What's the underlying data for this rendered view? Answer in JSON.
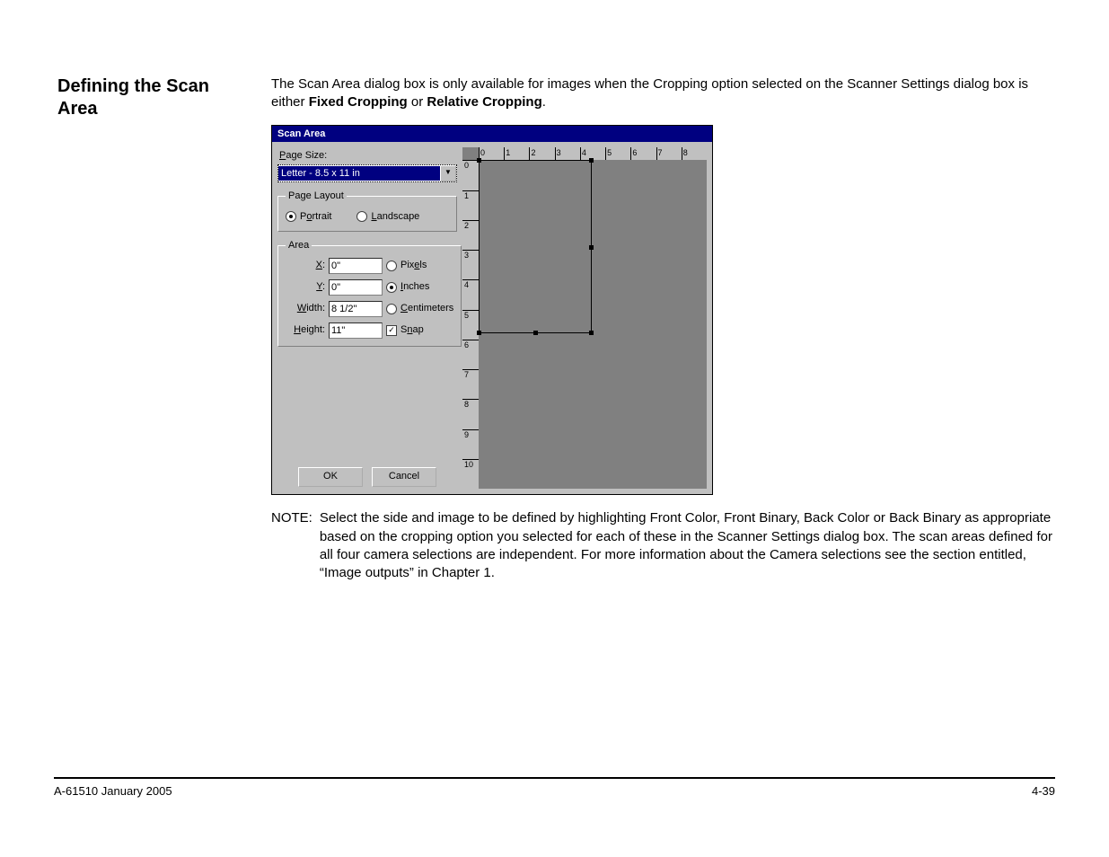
{
  "heading": "Defining the Scan Area",
  "intro": {
    "pre": "The Scan Area dialog box is only available for images when the Cropping option selected on the Scanner Settings dialog box is either ",
    "b1": "Fixed Cropping",
    "mid": " or ",
    "b2": "Relative Cropping",
    "post": "."
  },
  "dialog": {
    "title": "Scan Area",
    "page_size_label": "Page Size:",
    "page_size_value": "Letter - 8.5 x 11 in",
    "page_layout_legend": "Page Layout",
    "portrait": "Portrait",
    "landscape": "Landscape",
    "area_legend": "Area",
    "x_label": "X:",
    "y_label": "Y:",
    "width_label": "Width:",
    "height_label": "Height:",
    "x_value": "0\"",
    "y_value": "0\"",
    "width_value": "8 1/2\"",
    "height_value": "11\"",
    "pixels": "Pixels",
    "inches": "Inches",
    "centimeters": "Centimeters",
    "snap": "Snap",
    "ok": "OK",
    "cancel": "Cancel",
    "ruler_h": [
      "0",
      "1",
      "2",
      "3",
      "4",
      "5",
      "6",
      "7",
      "8"
    ],
    "ruler_v": [
      "0",
      "1",
      "2",
      "3",
      "4",
      "5",
      "6",
      "7",
      "8",
      "9",
      "10"
    ]
  },
  "note_label": "NOTE:",
  "note_text": "Select the side and image to be defined by highlighting Front Color, Front Binary, Back Color or Back Binary as appropriate based on the cropping option you selected for each of these in the Scanner Settings dialog box. The scan areas defined for all four camera selections are independent. For more information about the Camera selections see the section entitled, “Image outputs” in Chapter 1.",
  "footer_left": "A-61510 January 2005",
  "footer_right": "4-39"
}
